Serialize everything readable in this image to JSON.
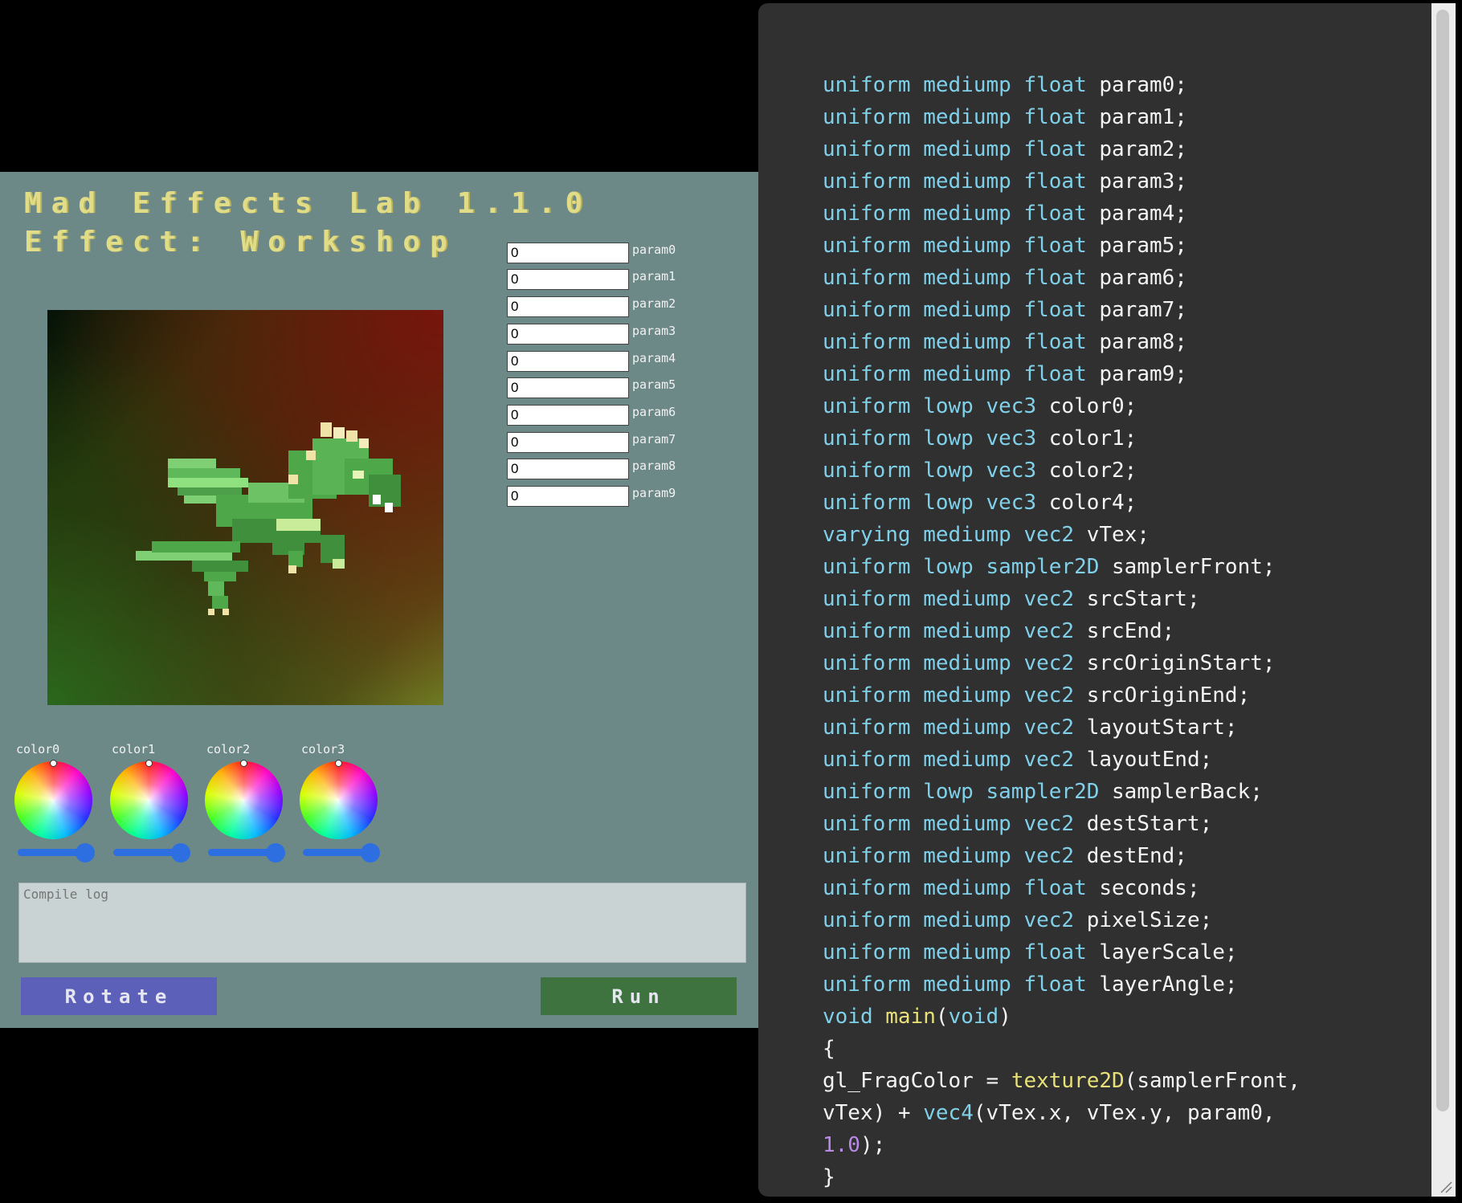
{
  "app": {
    "title": "Mad Effects Lab 1.1.0",
    "effect_line": "Effect: Workshop"
  },
  "params": [
    {
      "label": "param0",
      "value": "0"
    },
    {
      "label": "param1",
      "value": "0"
    },
    {
      "label": "param2",
      "value": "0"
    },
    {
      "label": "param3",
      "value": "0"
    },
    {
      "label": "param4",
      "value": "0"
    },
    {
      "label": "param5",
      "value": "0"
    },
    {
      "label": "param6",
      "value": "0"
    },
    {
      "label": "param7",
      "value": "0"
    },
    {
      "label": "param8",
      "value": "0"
    },
    {
      "label": "param9",
      "value": "0"
    }
  ],
  "colors": [
    {
      "label": "color0"
    },
    {
      "label": "color1"
    },
    {
      "label": "color2"
    },
    {
      "label": "color3"
    }
  ],
  "compile_log": {
    "placeholder": "Compile log"
  },
  "buttons": {
    "rotate": "Rotate",
    "run": "Run"
  },
  "editor": {
    "lines": [
      [
        [
          "kw",
          "uniform mediump float "
        ],
        [
          "t",
          "param0;"
        ]
      ],
      [
        [
          "kw",
          "uniform mediump float "
        ],
        [
          "t",
          "param1;"
        ]
      ],
      [
        [
          "kw",
          "uniform mediump float "
        ],
        [
          "t",
          "param2;"
        ]
      ],
      [
        [
          "kw",
          "uniform mediump float "
        ],
        [
          "t",
          "param3;"
        ]
      ],
      [
        [
          "kw",
          "uniform mediump float "
        ],
        [
          "t",
          "param4;"
        ]
      ],
      [
        [
          "kw",
          "uniform mediump float "
        ],
        [
          "t",
          "param5;"
        ]
      ],
      [
        [
          "kw",
          "uniform mediump float "
        ],
        [
          "t",
          "param6;"
        ]
      ],
      [
        [
          "kw",
          "uniform mediump float "
        ],
        [
          "t",
          "param7;"
        ]
      ],
      [
        [
          "kw",
          "uniform mediump float "
        ],
        [
          "t",
          "param8;"
        ]
      ],
      [
        [
          "kw",
          "uniform mediump float "
        ],
        [
          "t",
          "param9;"
        ]
      ],
      [
        [
          "kw",
          "uniform lowp vec3 "
        ],
        [
          "t",
          "color0;"
        ]
      ],
      [
        [
          "kw",
          "uniform lowp vec3 "
        ],
        [
          "t",
          "color1;"
        ]
      ],
      [
        [
          "kw",
          "uniform lowp vec3 "
        ],
        [
          "t",
          "color2;"
        ]
      ],
      [
        [
          "kw",
          "uniform lowp vec3 "
        ],
        [
          "t",
          "color4;"
        ]
      ],
      [
        [
          "kw",
          "varying mediump vec2 "
        ],
        [
          "t",
          "vTex;"
        ]
      ],
      [
        [
          "kw",
          "uniform lowp sampler2D "
        ],
        [
          "t",
          "samplerFront;"
        ]
      ],
      [
        [
          "kw",
          "uniform mediump vec2 "
        ],
        [
          "t",
          "srcStart;"
        ]
      ],
      [
        [
          "kw",
          "uniform mediump vec2 "
        ],
        [
          "t",
          "srcEnd;"
        ]
      ],
      [
        [
          "kw",
          "uniform mediump vec2 "
        ],
        [
          "t",
          "srcOriginStart;"
        ]
      ],
      [
        [
          "kw",
          "uniform mediump vec2 "
        ],
        [
          "t",
          "srcOriginEnd;"
        ]
      ],
      [
        [
          "kw",
          "uniform mediump vec2 "
        ],
        [
          "t",
          "layoutStart;"
        ]
      ],
      [
        [
          "kw",
          "uniform mediump vec2 "
        ],
        [
          "t",
          "layoutEnd;"
        ]
      ],
      [
        [
          "kw",
          "uniform lowp sampler2D "
        ],
        [
          "t",
          "samplerBack;"
        ]
      ],
      [
        [
          "kw",
          "uniform mediump vec2 "
        ],
        [
          "t",
          "destStart;"
        ]
      ],
      [
        [
          "kw",
          "uniform mediump vec2 "
        ],
        [
          "t",
          "destEnd;"
        ]
      ],
      [
        [
          "kw",
          "uniform mediump float "
        ],
        [
          "t",
          "seconds;"
        ]
      ],
      [
        [
          "kw",
          "uniform mediump vec2 "
        ],
        [
          "t",
          "pixelSize;"
        ]
      ],
      [
        [
          "kw",
          "uniform mediump float "
        ],
        [
          "t",
          "layerScale;"
        ]
      ],
      [
        [
          "kw",
          "uniform mediump float "
        ],
        [
          "t",
          "layerAngle;"
        ]
      ],
      [
        [
          "kw",
          "void "
        ],
        [
          "fn",
          "main"
        ],
        [
          "t",
          "("
        ],
        [
          "kw",
          "void"
        ],
        [
          "t",
          ")"
        ]
      ],
      [
        [
          "t",
          "{"
        ]
      ],
      [
        [
          "t",
          "gl_FragColor = "
        ],
        [
          "fn",
          "texture2D"
        ],
        [
          "t",
          "(samplerFront,"
        ]
      ],
      [
        [
          "t",
          "vTex) + "
        ],
        [
          "kw",
          "vec4"
        ],
        [
          "t",
          "(vTex.x, vTex.y, param0,"
        ]
      ],
      [
        [
          "num",
          "1.0"
        ],
        [
          "t",
          ");"
        ]
      ],
      [
        [
          "t",
          "}"
        ]
      ]
    ]
  }
}
